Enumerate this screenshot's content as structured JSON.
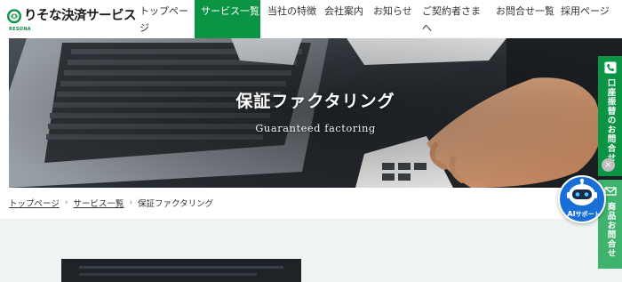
{
  "header": {
    "logo_text": "りそな決済サービス",
    "logo_sub": "RESONA",
    "nav": [
      {
        "label": "トップページ",
        "active": false
      },
      {
        "label": "サービス一覧",
        "active": true
      },
      {
        "label": "当社の特徴",
        "active": false
      },
      {
        "label": "会社案内",
        "active": false
      },
      {
        "label": "お知らせ",
        "active": false
      },
      {
        "label": "ご契約者さまへ",
        "active": false
      },
      {
        "label": "お問合せ一覧",
        "active": false
      },
      {
        "label": "採用ページ",
        "active": false
      }
    ]
  },
  "hero": {
    "title": "保証ファクタリング",
    "subtitle": "Guaranteed factoring"
  },
  "breadcrumb": {
    "items": [
      "トップページ",
      "サービス一覧"
    ],
    "current": "保証ファクタリング"
  },
  "side": {
    "account_label": "口座振替のお問合せ",
    "product_label": "商品お問合せ",
    "close_label": "×",
    "ai_label_ai": "AI",
    "ai_label_rest": "サポート"
  },
  "colors": {
    "brand_green": "#0b9444",
    "brand_green_light": "#3fb36e",
    "ai_blue": "#1a6fd6"
  },
  "icons": [
    "resona-logo-icon",
    "phone-icon",
    "mail-icon",
    "robot-icon",
    "close-icon",
    "chevron-right-icon"
  ]
}
